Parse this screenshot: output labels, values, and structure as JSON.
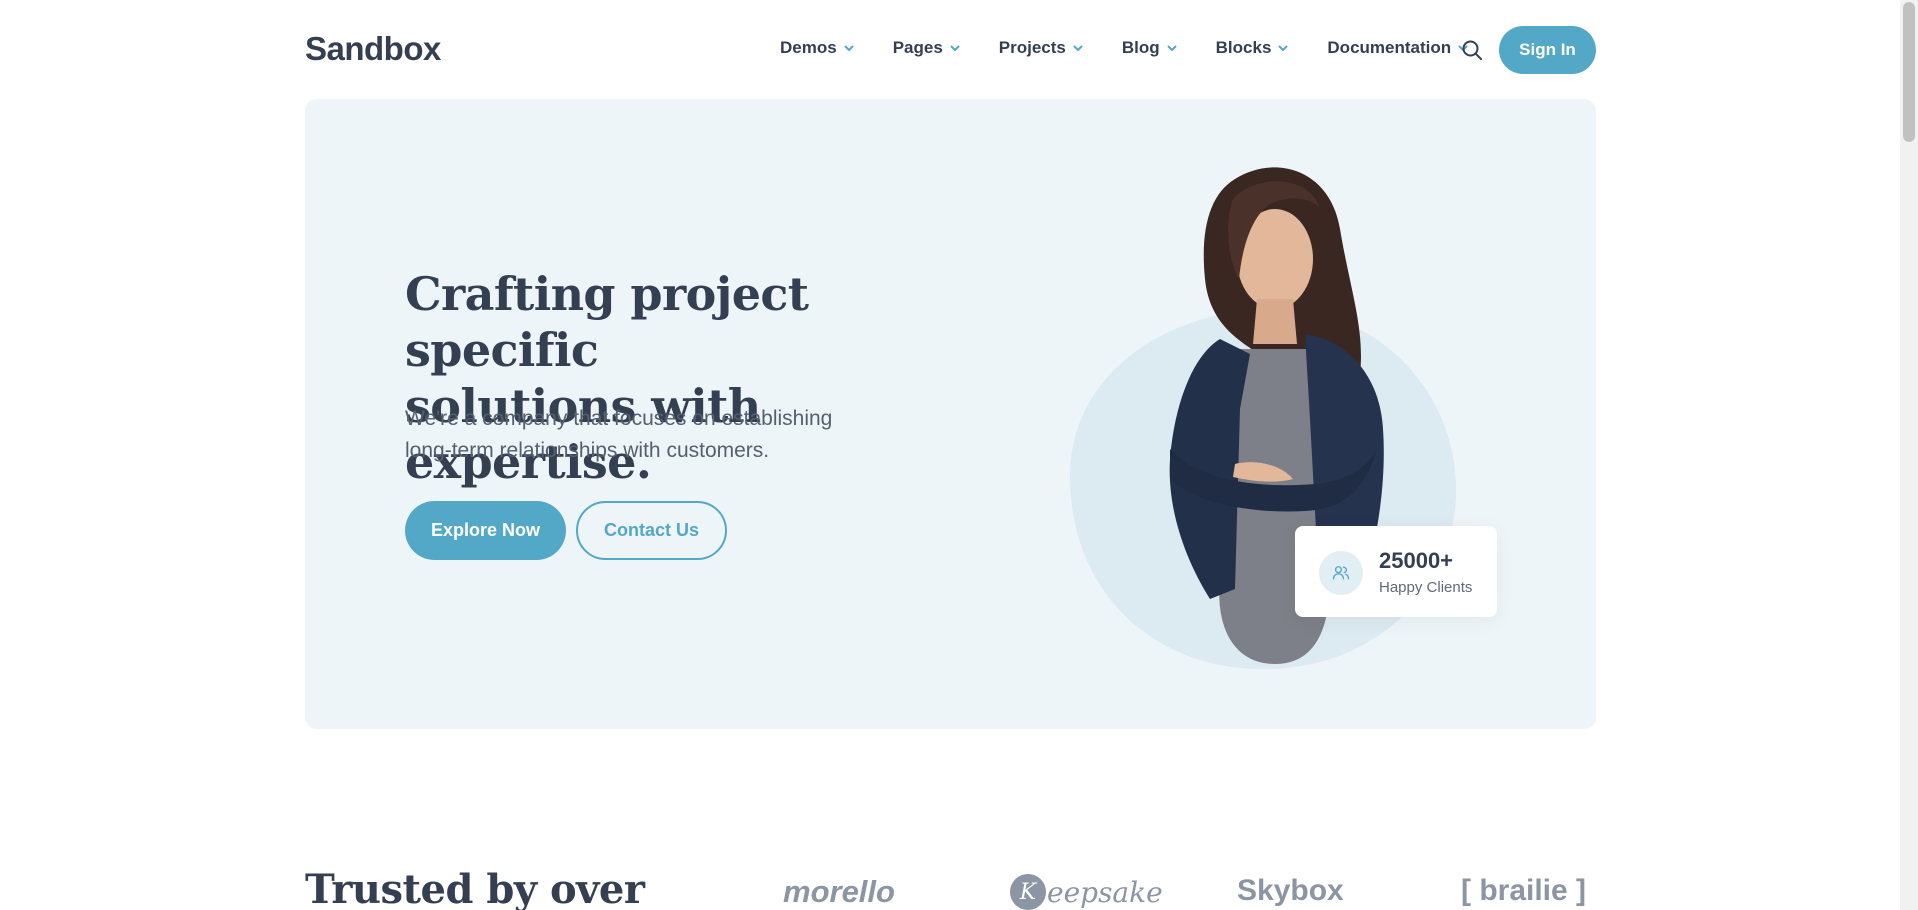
{
  "header": {
    "logo": "Sandbox",
    "nav": [
      {
        "label": "Demos"
      },
      {
        "label": "Pages"
      },
      {
        "label": "Projects"
      },
      {
        "label": "Blog"
      },
      {
        "label": "Blocks"
      },
      {
        "label": "Documentation"
      }
    ],
    "signin_label": "Sign In",
    "search_icon": "search-icon"
  },
  "hero": {
    "title_line1": "Crafting project specific",
    "title_line2": "solutions with expertise.",
    "subtitle_line1": "We're a company that focuses on establishing",
    "subtitle_line2": "long-term relationships with customers.",
    "primary_label": "Explore Now",
    "secondary_label": "Contact Us",
    "stat": {
      "value": "25000+",
      "label": "Happy Clients",
      "icon": "users-icon"
    }
  },
  "trusted": {
    "title": "Trusted by over",
    "brands": [
      "morello",
      "eepsake",
      "Skybox",
      "[ brailie ]"
    ],
    "keepsake_initial": "K"
  },
  "colors": {
    "accent": "#54a8c7",
    "hero_bg": "#eef5f9",
    "text": "#343f52",
    "muted": "#60697b",
    "brand_gray": "#8b95a3"
  }
}
